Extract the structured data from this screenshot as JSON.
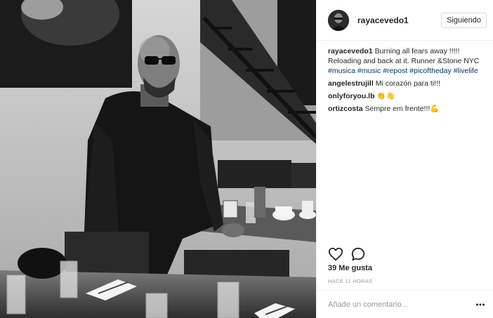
{
  "post": {
    "username": "rayacevedo1",
    "follow_label": "Siguiendo",
    "caption": {
      "user": "rayacevedo1",
      "text": "Burning all fears away !!!!! Reloading and back at it. Runner &Stone NYC",
      "hashtags": [
        "#musica",
        "#music",
        "#repost",
        "#picoftheday",
        "#livelife"
      ]
    },
    "comments": [
      {
        "user": "angelestrujill",
        "text": "Mi corazón para ti!!!"
      },
      {
        "user": "onlyforyou.lb",
        "text": "👏👋"
      },
      {
        "user": "ortizcosta",
        "text": "Sempre em frente!!!💪"
      }
    ],
    "likes_text": "39 Me gusta",
    "timestamp": "Hace 11 horas",
    "comment_placeholder": "Añade un comentario..."
  },
  "icons": {
    "like": "heart-icon",
    "comment": "speech-bubble-icon",
    "more": "more-options-icon"
  },
  "colors": {
    "hashtag": "#003569",
    "border": "#efefef",
    "muted": "#999999",
    "text": "#262626"
  }
}
